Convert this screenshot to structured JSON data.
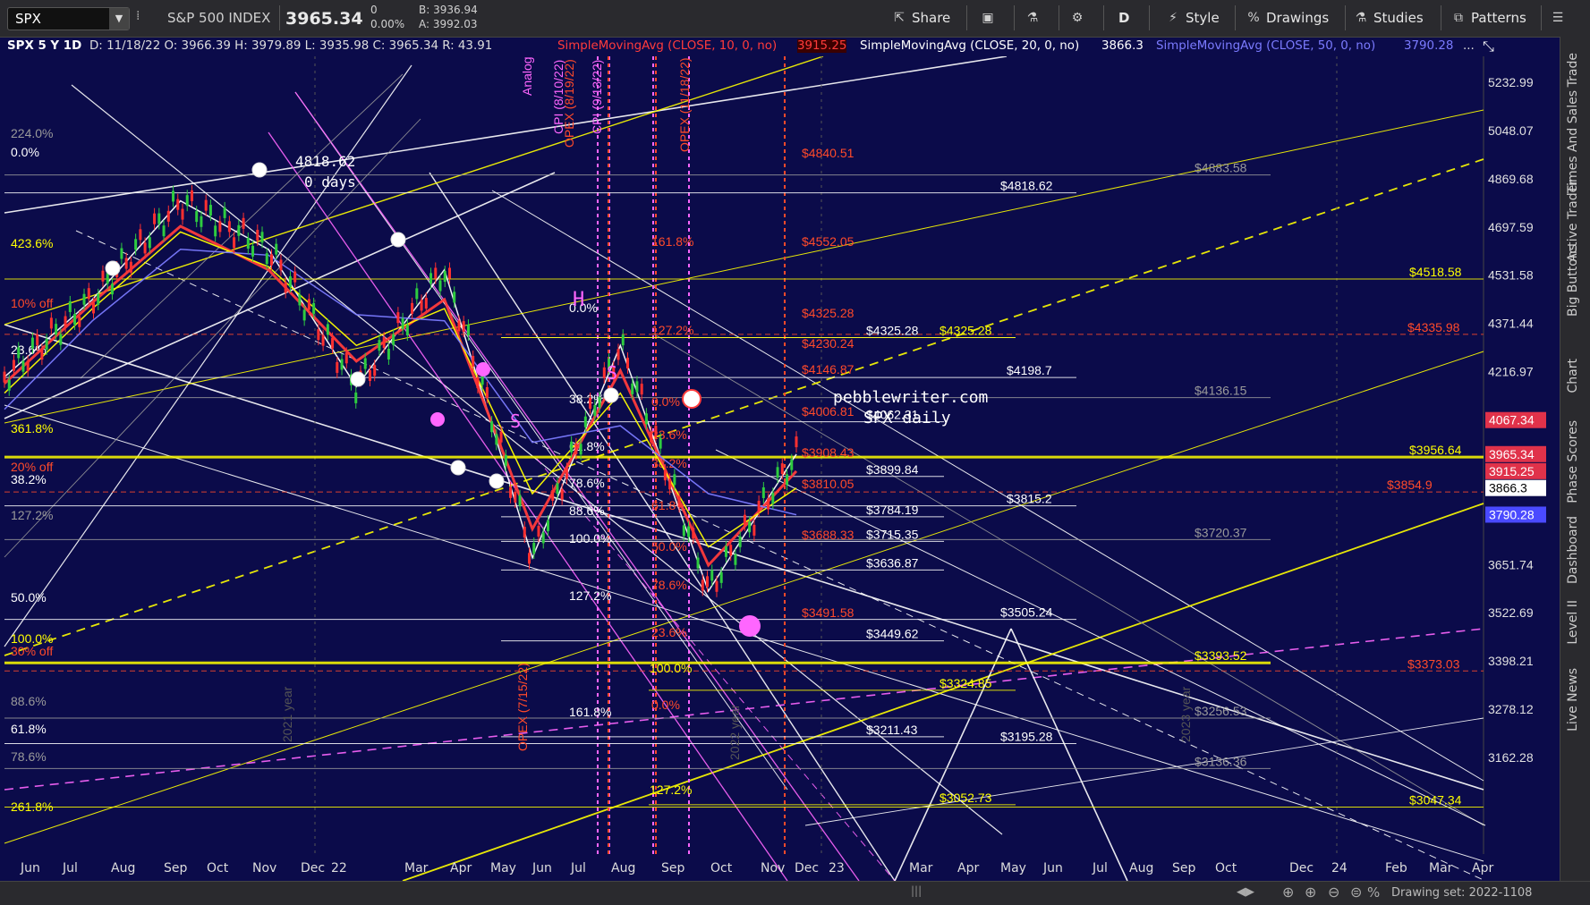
{
  "toolbar": {
    "symbol": "SPX",
    "name": "S&P 500 INDEX",
    "last": "3965.34",
    "change": "0",
    "change_pct": "0.00%",
    "bid": "B: 3936.94",
    "ask": "A: 3992.03",
    "buttons": [
      {
        "label": "Share",
        "icon": "share-icon"
      },
      {
        "label": "",
        "icon": "screenshot-icon"
      },
      {
        "label": "",
        "icon": "flask-icon"
      },
      {
        "label": "",
        "icon": "gear-icon"
      },
      {
        "label": "D",
        "icon": ""
      },
      {
        "label": "Style",
        "icon": "style-icon"
      },
      {
        "label": "Drawings",
        "icon": "drawings-icon"
      },
      {
        "label": "Studies",
        "icon": "studies-icon"
      },
      {
        "label": "Patterns",
        "icon": "patterns-icon"
      }
    ]
  },
  "study_header": {
    "title": "SPX 5 Y 1D",
    "ohlc": "D: 11/18/22  O: 3966.39  H: 3979.89  L: 3935.98  C: 3965.34  R: 43.91",
    "sma10_label": "SimpleMovingAvg (CLOSE, 10, 0, no)",
    "sma10_value": "3915.25",
    "sma20_label": "SimpleMovingAvg (CLOSE, 20, 0, no)",
    "sma20_value": "3866.3",
    "sma50_label": "SimpleMovingAvg (CLOSE, 50, 0, no)",
    "sma50_value": "3790.28",
    "more": "..."
  },
  "colors": {
    "background": "#0b0b4a",
    "sma10": "#ff3b3b",
    "sma20": "#ffffff",
    "sma50": "#7b7bff",
    "price_highlight": "#e0324a",
    "yellow": "#ffff00",
    "magenta": "#ff66ff",
    "orange_red": "#ff4a2a"
  },
  "chart_data": {
    "type": "line",
    "title": "SPX daily",
    "watermark": "pebblewriter.com",
    "ylim": [
      3050,
      5320
    ],
    "price_axis_labels": [
      "5232.99",
      "5048.07",
      "4869.68",
      "4697.59",
      "4531.58",
      "4371.44",
      "4216.97",
      "3651.74",
      "3522.69",
      "3398.21",
      "3278.12",
      "3162.28"
    ],
    "price_tags": [
      {
        "text": "4067.34",
        "color": "#e0324a"
      },
      {
        "text": "3965.34",
        "color": "#e0324a"
      },
      {
        "text": "3915.25",
        "color": "#e0324a"
      },
      {
        "text": "3866.3",
        "color": "#ffffff"
      },
      {
        "text": "3790.28",
        "color": "#4a4aff"
      }
    ],
    "x_tick_labels": [
      "Jun",
      "Jul",
      "Aug",
      "Sep",
      "Oct",
      "Nov",
      "Dec",
      "22",
      "Mar",
      "Apr",
      "May",
      "Jun",
      "Jul",
      "Aug",
      "Sep",
      "Oct",
      "Nov",
      "Dec",
      "23",
      "Mar",
      "Apr",
      "May",
      "Jun",
      "Jul",
      "Aug",
      "Sep",
      "Oct",
      "Dec",
      "24",
      "Feb",
      "Mar",
      "Apr"
    ],
    "year_separators": [
      "2021 year",
      "2022 year",
      "2023 year"
    ],
    "series": [
      {
        "name": "SPX",
        "x": [
          "2021-06",
          "2021-09",
          "2021-12",
          "2022-01",
          "2022-03",
          "2022-04",
          "2022-06",
          "2022-08",
          "2022-10",
          "2022-11"
        ],
        "values": [
          4200,
          4450,
          4790,
          4620,
          4170,
          4550,
          3670,
          4300,
          3580,
          3965
        ]
      },
      {
        "name": "SMA 10",
        "values": [
          4180,
          4440,
          4700,
          4550,
          4250,
          4450,
          3750,
          4220,
          3650,
          3915
        ]
      },
      {
        "name": "SMA 20",
        "values": [
          4150,
          4420,
          4680,
          4560,
          4300,
          4420,
          3850,
          4150,
          3700,
          3866
        ]
      },
      {
        "name": "SMA 50",
        "values": [
          4100,
          4380,
          4620,
          4600,
          4400,
          4380,
          4000,
          4050,
          3850,
          3790
        ]
      }
    ],
    "price_levels": [
      {
        "text": "$4818.62",
        "value": 4818.62,
        "color": "#ffffff"
      },
      {
        "text": "$4518.58",
        "value": 4518.58,
        "color": "#ffff00"
      },
      {
        "text": "$4335.98",
        "value": 4335.98,
        "color": "#ff4a2a"
      },
      {
        "text": "$4325.28",
        "value": 4325.28,
        "color": "#ffffff"
      },
      {
        "text": "$4325.28",
        "value": 4325.28,
        "color": "#ffff00"
      },
      {
        "text": "$4198.7",
        "value": 4198.7,
        "color": "#ffffff"
      },
      {
        "text": "$4136.15",
        "value": 4136.15,
        "color": "#9a9a9a"
      },
      {
        "text": "$4062.31",
        "value": 4062.31,
        "color": "#ffffff"
      },
      {
        "text": "$3956.64",
        "value": 3956.64,
        "color": "#ffff00"
      },
      {
        "text": "$3899.84",
        "value": 3899.84,
        "color": "#ffffff"
      },
      {
        "text": "$3854.9",
        "value": 3854.9,
        "color": "#ff4a2a"
      },
      {
        "text": "$3815.2",
        "value": 3815.2,
        "color": "#ffffff"
      },
      {
        "text": "$3784.19",
        "value": 3784.19,
        "color": "#ffffff"
      },
      {
        "text": "$3720.37",
        "value": 3720.37,
        "color": "#9a9a9a"
      },
      {
        "text": "$3715.35",
        "value": 3715.35,
        "color": "#ffffff"
      },
      {
        "text": "$3636.87",
        "value": 3636.87,
        "color": "#ffffff"
      },
      {
        "text": "$3505.24",
        "value": 3505.24,
        "color": "#ffffff"
      },
      {
        "text": "$3449.62",
        "value": 3449.62,
        "color": "#ffffff"
      },
      {
        "text": "$3393.52",
        "value": 3393.52,
        "color": "#ffff00"
      },
      {
        "text": "$3373.03",
        "value": 3373.03,
        "color": "#ff4a2a"
      },
      {
        "text": "$3324.85",
        "value": 3324.85,
        "color": "#ffff00"
      },
      {
        "text": "$3256.53",
        "value": 3256.53,
        "color": "#9a9a9a"
      },
      {
        "text": "$3211.43",
        "value": 3211.43,
        "color": "#ffffff"
      },
      {
        "text": "$3195.28",
        "value": 3195.28,
        "color": "#ffffff"
      },
      {
        "text": "$3136.36",
        "value": 3136.36,
        "color": "#9a9a9a"
      },
      {
        "text": "$3052.73",
        "value": 3052.73,
        "color": "#ffff00"
      },
      {
        "text": "$3047.34",
        "value": 3047.34,
        "color": "#ffff00"
      },
      {
        "text": "$4883.58",
        "value": 4883.58,
        "color": "#9a9a9a"
      }
    ],
    "fib_levels_left": [
      {
        "text": "224.0%",
        "color": "#9a9a9a"
      },
      {
        "text": "0.0%",
        "color": "#ffffff"
      },
      {
        "text": "423.6%",
        "color": "#ffff00"
      },
      {
        "text": "10% off",
        "color": "#ff4a2a"
      },
      {
        "text": "23.6%",
        "color": "#ffffff"
      },
      {
        "text": "361.8%",
        "color": "#ffff00"
      },
      {
        "text": "20% off",
        "color": "#ff4a2a"
      },
      {
        "text": "38.2%",
        "color": "#ffffff"
      },
      {
        "text": "127.2%",
        "color": "#9a9a9a"
      },
      {
        "text": "50.0%",
        "color": "#ffffff"
      },
      {
        "text": "100.0%",
        "color": "#ffff00"
      },
      {
        "text": "30% off",
        "color": "#ff4a2a"
      },
      {
        "text": "88.6%",
        "color": "#9a9a9a"
      },
      {
        "text": "61.8%",
        "color": "#ffffff"
      },
      {
        "text": "78.6%",
        "color": "#9a9a9a"
      },
      {
        "text": "261.8%",
        "color": "#ffff00"
      }
    ],
    "fib_levels_mid": [
      {
        "text": "0.0%",
        "color": "#ffffff"
      },
      {
        "text": "38.2%",
        "color": "#ffffff"
      },
      {
        "text": "61.8%",
        "color": "#ffffff"
      },
      {
        "text": "78.6%",
        "color": "#ffffff"
      },
      {
        "text": "88.6%",
        "color": "#ffffff"
      },
      {
        "text": "100.0%",
        "color": "#ffffff"
      },
      {
        "text": "127.2%",
        "color": "#ffffff"
      },
      {
        "text": "161.8%",
        "color": "#ffffff"
      },
      {
        "text": "100.0%",
        "color": "#ffff00"
      },
      {
        "text": "127.2%",
        "color": "#ffff00"
      }
    ],
    "fib_levels_red": [
      {
        "text": "161.8%",
        "color": "#ff4a2a"
      },
      {
        "text": "127.2%",
        "color": "#ff4a2a"
      },
      {
        "text": "0.0%",
        "color": "#ff4a2a"
      },
      {
        "text": "23.6%",
        "color": "#ff4a2a"
      },
      {
        "text": "38.2%",
        "color": "#ff4a2a"
      },
      {
        "text": "61.8%",
        "color": "#ff4a2a"
      },
      {
        "text": "50.0%",
        "color": "#ff4a2a"
      },
      {
        "text": "78.6%",
        "color": "#ff4a2a"
      },
      {
        "text": "23.6%",
        "color": "#ff4a2a"
      },
      {
        "text": "0.0%",
        "color": "#ff4a2a"
      }
    ],
    "red_price_labels": [
      "$4840.51",
      "$4552.05",
      "$4325.28",
      "$4230.24",
      "$4146.87",
      "$4006.81",
      "$3908.43",
      "$3810.05",
      "$3688.33",
      "$3491.58"
    ],
    "annotations": [
      {
        "text": "4818.62",
        "color": "#ffffff"
      },
      {
        "text": "0 days",
        "color": "#ffffff"
      },
      {
        "text": "H",
        "color": "#ff66ff"
      },
      {
        "text": "S",
        "color": "#ff66ff"
      },
      {
        "text": "S",
        "color": "#ff66ff"
      },
      {
        "text": "pebblewriter.com",
        "color": "#ffffff"
      },
      {
        "text": "SPX daily",
        "color": "#ffffff"
      }
    ],
    "vertical_events": [
      {
        "text": "Analog",
        "color": "#ff66ff"
      },
      {
        "text": "CPI (8/10/22)",
        "color": "#ff66ff"
      },
      {
        "text": "OPEX (8/19/22)",
        "color": "#ff4a2a"
      },
      {
        "text": "CPI (9/13/22)",
        "color": "#ff66ff"
      },
      {
        "text": "OPEX (11/18/22)",
        "color": "#ff4a2a"
      },
      {
        "text": "OPEX (7/15/22)",
        "color": "#ff4a2a"
      }
    ]
  },
  "right_rail": [
    "Trade",
    "Times And Sales",
    "Active Trader",
    "Big Buttons",
    "Chart",
    "Phase Scores",
    "Dashboard",
    "Level II",
    "Live News"
  ],
  "bottom": {
    "status": "Drawing set: 2022-1108"
  }
}
